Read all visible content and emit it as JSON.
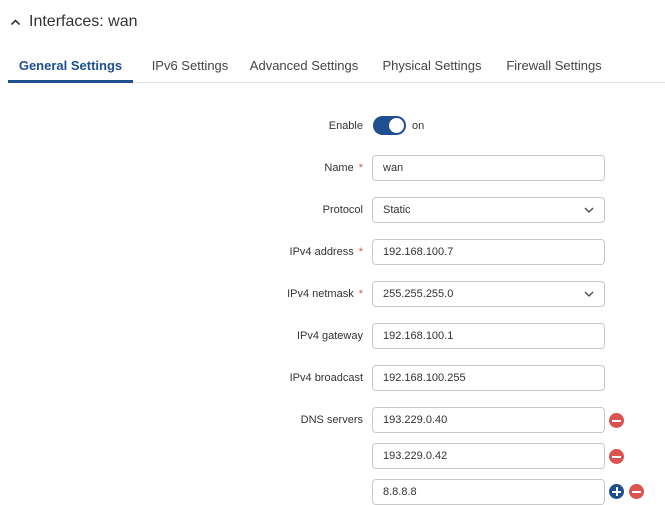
{
  "header": {
    "title": "Interfaces: wan",
    "collapse_icon": "chevron-up-icon"
  },
  "tabs": [
    {
      "label": "General Settings",
      "active": true
    },
    {
      "label": "IPv6 Settings",
      "active": false
    },
    {
      "label": "Advanced Settings",
      "active": false
    },
    {
      "label": "Physical Settings",
      "active": false
    },
    {
      "label": "Firewall Settings",
      "active": false
    }
  ],
  "form": {
    "enable": {
      "label": "Enable",
      "state": "on"
    },
    "name": {
      "label": "Name",
      "required_mark": "*",
      "value": "wan"
    },
    "protocol": {
      "label": "Protocol",
      "value": "Static"
    },
    "ipv4_address": {
      "label": "IPv4 address",
      "required_mark": "*",
      "value": "192.168.100.7"
    },
    "ipv4_netmask": {
      "label": "IPv4 netmask",
      "required_mark": "*",
      "value": "255.255.255.0"
    },
    "ipv4_gateway": {
      "label": "IPv4 gateway",
      "value": "192.168.100.1"
    },
    "ipv4_broadcast": {
      "label": "IPv4 broadcast",
      "value": "192.168.100.255"
    },
    "dns_servers": {
      "label": "DNS servers",
      "values": [
        "193.229.0.40",
        "193.229.0.42",
        "8.8.8.8"
      ]
    }
  },
  "colors": {
    "accent": "#1d4f91",
    "remove": "#d9534f",
    "required": "#d9534f"
  }
}
